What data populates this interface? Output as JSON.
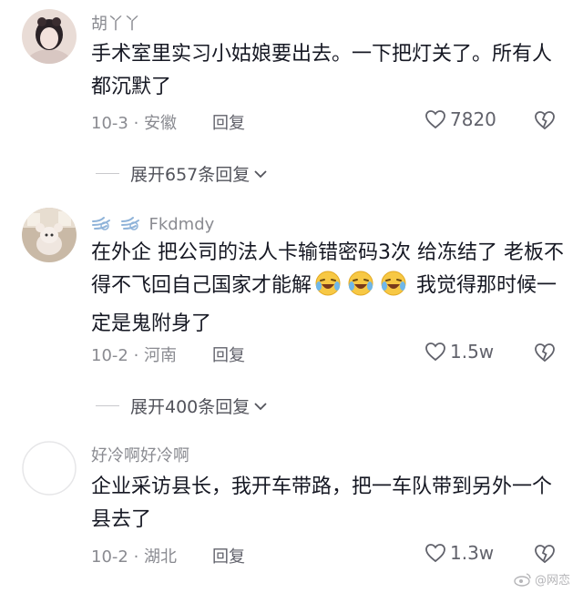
{
  "comments": [
    {
      "username": "胡丫丫",
      "text": "手术室里实习小姑娘要出去。一下把灯关了。所有人都沉默了",
      "meta": "10-3 · 安徽",
      "reply": "回复",
      "likes": "7820"
    },
    {
      "username": "Fkdmdy",
      "text_a": "在外企 把公司的法人卡输错密码3次 给冻结了 老板不得不飞回自己国家才能解",
      "text_b": " 我觉得那时候一定是鬼附身了",
      "meta": "10-2 · 河南",
      "reply": "回复",
      "likes": "1.5w"
    },
    {
      "username": "好冷啊好冷啊",
      "text": "企业采访县长，我开车带路，把一车队带到另外一个县去了",
      "meta": "10-2 · 湖北",
      "reply": "回复",
      "likes": "1.3w"
    }
  ],
  "expand": [
    "展开657条回复",
    "展开400条回复"
  ],
  "watermark": "@网恋",
  "icons": {
    "like": "heart-outline-icon",
    "dislike": "broken-heart-icon",
    "expand": "chevron-down-icon",
    "weibo": "weibo-logo-icon",
    "emoji": "laughing-tears-emoji"
  }
}
